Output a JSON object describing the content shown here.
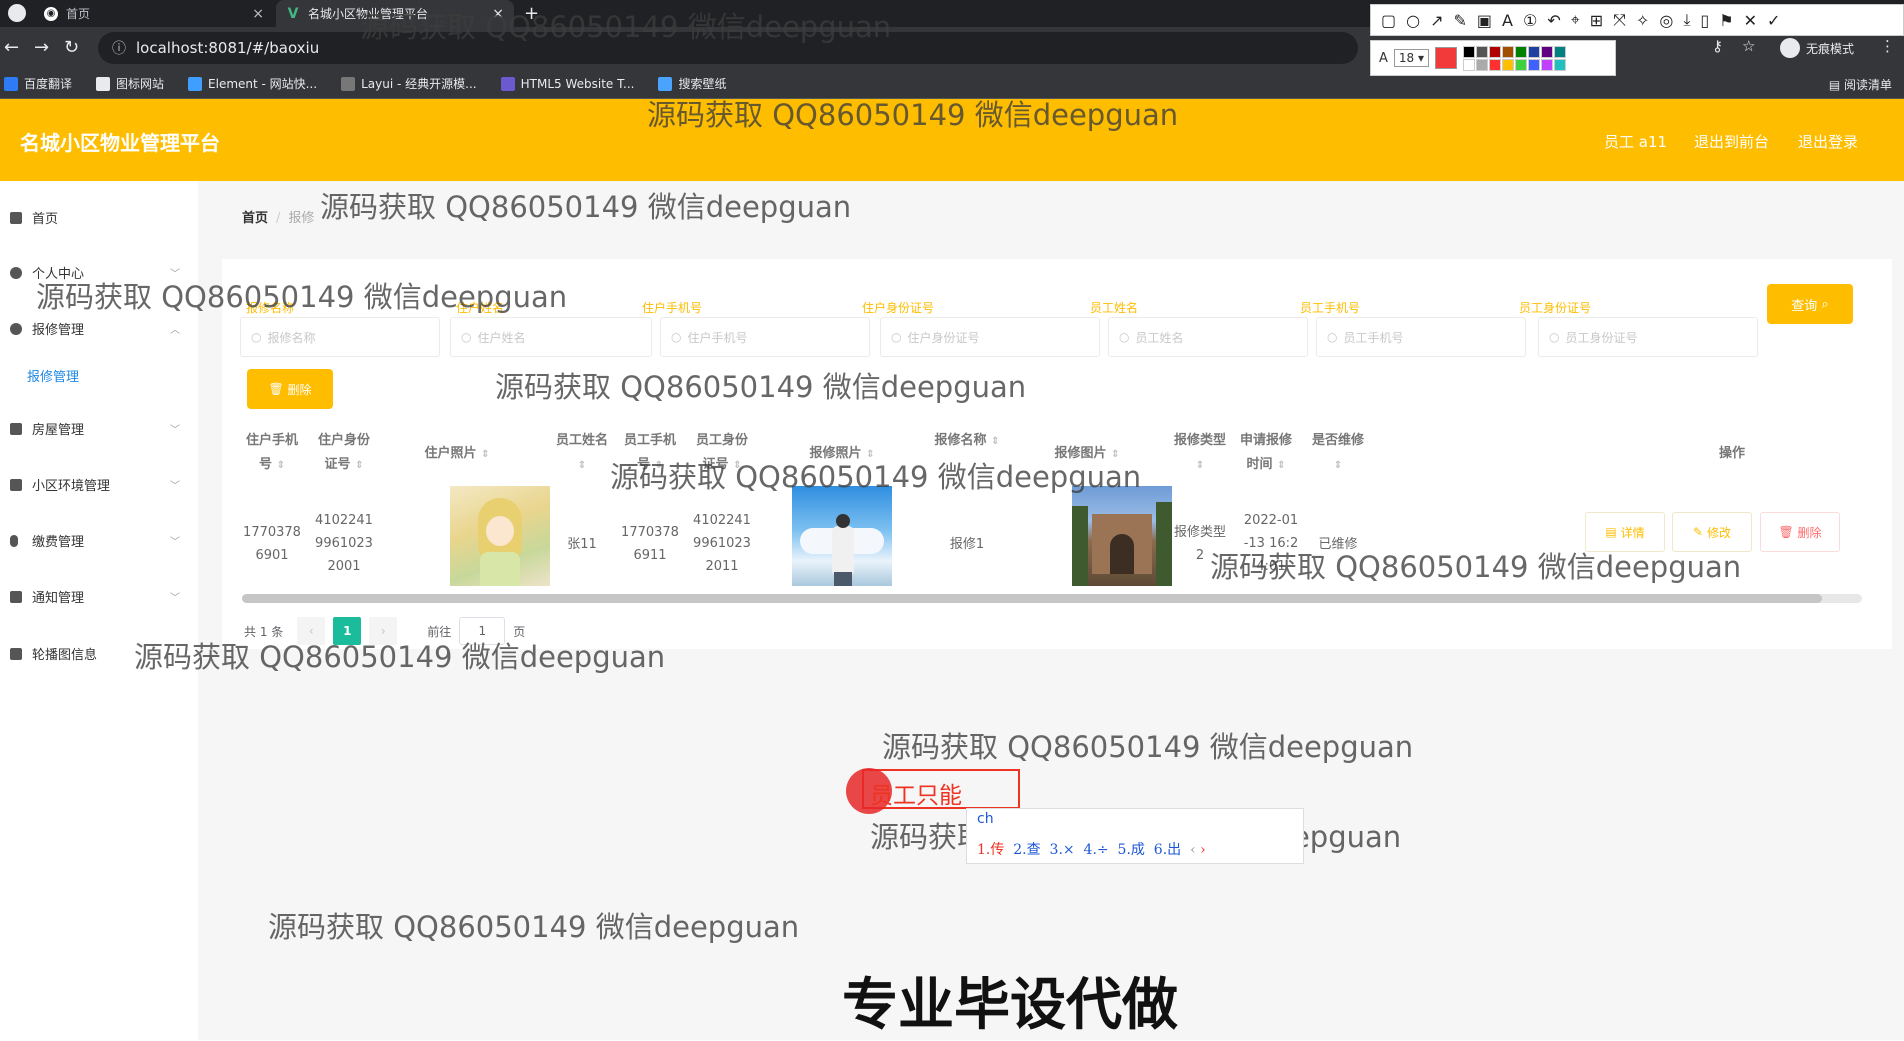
{
  "browser": {
    "tabs": [
      {
        "title": "首页",
        "active": false
      },
      {
        "title": "名城小区物业管理平台",
        "active": true
      }
    ],
    "new_tab_icon": "plus-icon",
    "url": "localhost:8081/#/baoxiu",
    "incognito_label": "无痕模式",
    "bookmarks": [
      "百度翻译",
      "图标网站",
      "Element - 网站快...",
      "Layui - 经典开源模...",
      "HTML5 Website T...",
      "搜索壁纸"
    ],
    "reading_list": "阅读清单"
  },
  "annotation_toolbar": {
    "font_size": "18",
    "active_color": "#f23a3a",
    "palette": [
      "#000000",
      "#555555",
      "#b00000",
      "#a05000",
      "#008000",
      "#2040a0",
      "#600080",
      "#008080",
      "#ffffff",
      "#aaaaaa",
      "#ff3030",
      "#ffc000",
      "#40d040",
      "#4060ff",
      "#c040ff",
      "#20c0c0"
    ]
  },
  "header": {
    "brand": "名城小区物业管理平台",
    "user_label": "员工 a11",
    "back_to_front": "退出到前台",
    "logout": "退出登录",
    "accent_color": "#ffbd00"
  },
  "sidebar": {
    "items": [
      {
        "label": "首页",
        "icon": "home-icon"
      },
      {
        "label": "个人中心",
        "icon": "user-icon"
      },
      {
        "label": "报修管理",
        "icon": "repair-icon"
      },
      {
        "label": "房屋管理",
        "icon": "house-icon"
      },
      {
        "label": "小区环境管理",
        "icon": "monitor-icon"
      },
      {
        "label": "缴费管理",
        "icon": "microphone-icon"
      },
      {
        "label": "通知管理",
        "icon": "notice-icon"
      },
      {
        "label": "轮播图信息",
        "icon": "carousel-icon"
      }
    ],
    "active_sub": "报修管理"
  },
  "breadcrumb": {
    "home": "首页",
    "current": "报修"
  },
  "filters": [
    {
      "label": "报修名称",
      "placeholder": "报修名称"
    },
    {
      "label": "住户姓名",
      "placeholder": "住户姓名"
    },
    {
      "label": "住户手机号",
      "placeholder": "住户手机号"
    },
    {
      "label": "住户身份证号",
      "placeholder": "住户身份证号"
    },
    {
      "label": "员工姓名",
      "placeholder": "员工姓名"
    },
    {
      "label": "员工手机号",
      "placeholder": "员工手机号"
    },
    {
      "label": "员工身份证号",
      "placeholder": "员工身份证号"
    }
  ],
  "buttons": {
    "query": "查询",
    "delete": "删除"
  },
  "table": {
    "headers": [
      "住户手机号",
      "住户身份证号",
      "住户照片",
      "员工姓名",
      "员工手机号",
      "员工身份证号",
      "报修照片",
      "报修名称",
      "报修图片",
      "报修类型",
      "申请报修时间",
      "是否维修",
      "操作"
    ],
    "row": {
      "resident_phone": "17703786901",
      "resident_phone_l1": "1770378",
      "resident_phone_l2": "6901",
      "resident_id_l1": "4102241",
      "resident_id_l2": "9961023",
      "resident_id_l3": "2001",
      "staff_name": "张11",
      "staff_phone_l1": "1770378",
      "staff_phone_l2": "6911",
      "staff_id_l1": "4102241",
      "staff_id_l2": "9961023",
      "staff_id_l3": "2011",
      "repair_name": "报修1",
      "repair_type_l1": "报修类型",
      "repair_type_l2": "2",
      "apply_time_l1": "2022-01",
      "apply_time_l2": "-13 16:2",
      "apply_time_l3": "4:01",
      "repaired": "已维修"
    },
    "actions": [
      "详情",
      "修改",
      "删除"
    ]
  },
  "pager": {
    "total": "共 1 条",
    "current_page": "1",
    "goto": "前往",
    "goto_value": "1",
    "page_unit": "页"
  },
  "overlay": {
    "watermark": "源码获取 QQ86050149 微信deepguan",
    "red_annotation": "员工只能",
    "ime_composing": "ch",
    "ime_candidates": [
      "1.传",
      "2.查",
      "3.×",
      "4.÷",
      "5.成",
      "6.出"
    ],
    "caption": "专业毕设代做"
  }
}
